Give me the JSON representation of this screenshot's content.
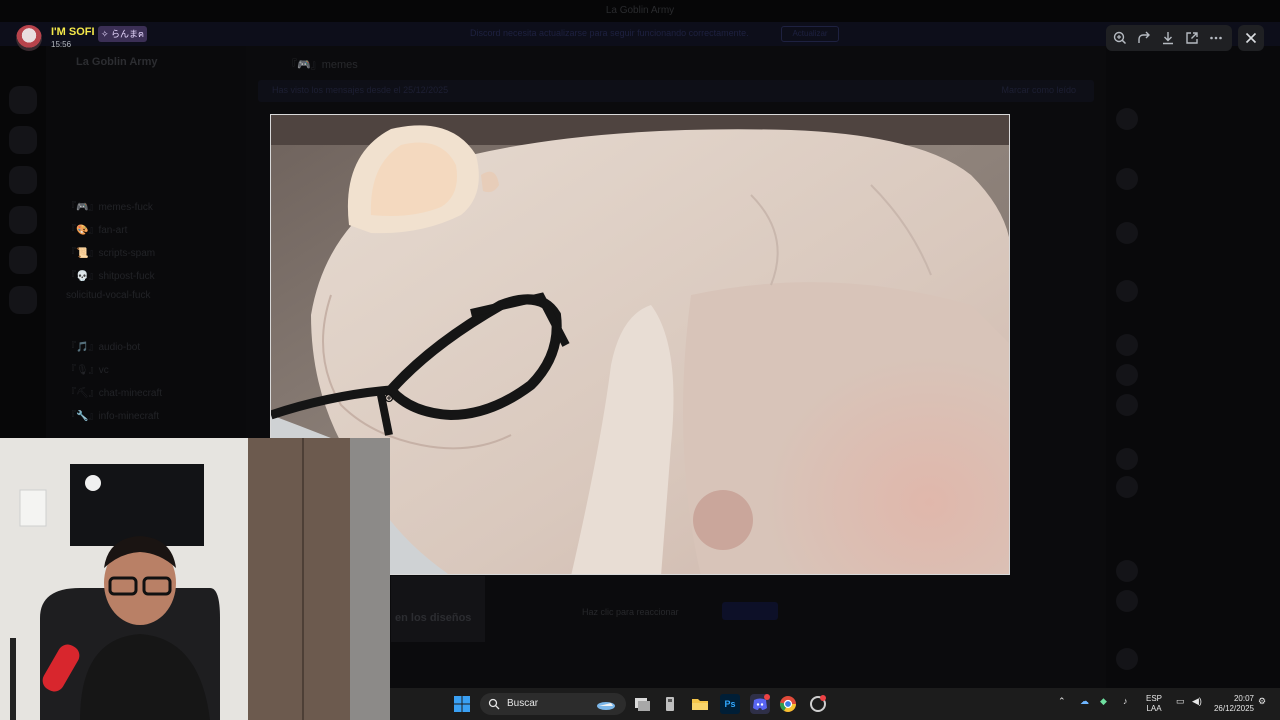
{
  "window": {
    "title": "La Goblin Army"
  },
  "banner": {
    "text": "Discord necesita actualizarse para seguir funcionando correctamente.",
    "button": "Actualizar"
  },
  "server": {
    "name": "La Goblin Army"
  },
  "channels": [
    "『🎮』memes-fuck",
    "『🎨』fan-art",
    "『📜』scripts-spam",
    "『💀』shitpost-fuck",
    "solicitud-vocal-fuck",
    "『🎵』audio-bot",
    "『🎙』vc",
    "『⛏』chat-minecraft",
    "『🔧』info-minecraft"
  ],
  "chat": {
    "channel_header": "『🎮』memes",
    "pinned_bar": "Has visto los mensajes desde el 25/12/2025",
    "pinned_right": "Marcar como leído",
    "attachment_caption": "en los diseños",
    "reaction_hint": "Haz clic para reaccionar"
  },
  "viewer": {
    "username": "I'M SOFI",
    "user_tag": "✧ らんまฅ",
    "timestamp": "15:56",
    "tools": [
      {
        "icon": "zoom-in-icon"
      },
      {
        "icon": "forward-icon"
      },
      {
        "icon": "download-icon"
      },
      {
        "icon": "open-external-icon"
      },
      {
        "icon": "more-icon"
      }
    ],
    "close_icon": "close-icon"
  },
  "taskbar": {
    "search_placeholder": "Buscar",
    "apps": [
      "windows-start-icon",
      "widgets-icon",
      "task-view-icon",
      "file-manager-icon",
      "folder-icon",
      "photoshop-icon",
      "discord-icon",
      "chrome-icon",
      "app-icon"
    ],
    "photoshop_label": "Ps",
    "lang_top": "ESP",
    "lang_bottom": "LAA",
    "time": "20:07",
    "date": "26/12/2025"
  },
  "colors": {
    "username": "#f5e94a",
    "accent": "#5865f2"
  }
}
